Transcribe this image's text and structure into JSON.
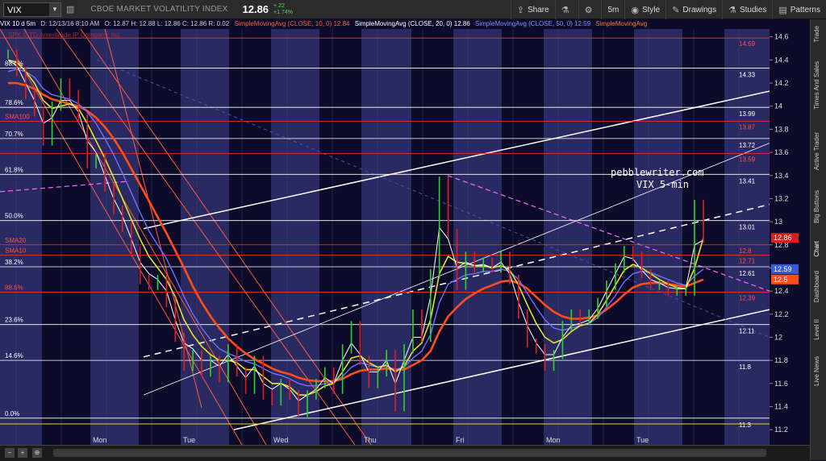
{
  "toolbar": {
    "symbol": "VIX",
    "company": "CBOE MARKET VOLATILITY INDEX",
    "last": "12.86",
    "change": "+.22",
    "change_pct": "+1.74%",
    "buttons": [
      {
        "label": "Share",
        "icon": "share-icon"
      },
      {
        "label": "",
        "icon": "flask-icon"
      },
      {
        "label": "",
        "icon": "gear-icon"
      },
      {
        "label": "5m",
        "icon": ""
      },
      {
        "label": "Style",
        "icon": "eye-icon"
      },
      {
        "label": "Drawings",
        "icon": "pencil-icon"
      },
      {
        "label": "Studies",
        "icon": "flask-icon"
      },
      {
        "label": "Patterns",
        "icon": "patterns-icon"
      }
    ]
  },
  "infobar": {
    "title": "VIX 10 d 5m",
    "date": "D: 12/13/16 8:10 AM",
    "ohlc": "O: 12.87  H: 12.88  L: 12.86  C: 12.86  R: 0.02",
    "sma10": "SimpleMovingAvg (CLOSE, 10, 0)  12.84",
    "sma20": "SimpleMovingAvg (CLOSE, 20, 0)  12.86",
    "sma50": "SimpleMovingAvg (CLOSE, 50, 0)  12.59",
    "sma100": "SimpleMovingAvg",
    "watermark": "SPX © TD Ameritrade IP Company, Inc."
  },
  "sidebar": [
    "Trade",
    "Times And Sales",
    "Active Trader",
    "Big Buttons",
    "Chart",
    "Dashboard",
    "Level II",
    "Live News"
  ],
  "annotation": {
    "line1": "pebblewriter.com",
    "line2": "VIX 5-min"
  },
  "colors": {
    "price": "#d32020",
    "sma10": "#ffffff",
    "sma20": "#e8e030",
    "sma50": "#7070ff",
    "sma100": "#ff4d1a",
    "fib": "#ffffff",
    "channel": "#ff5a3c",
    "pink": "#ff66ff"
  },
  "chart_data": {
    "type": "line",
    "title": "VIX 10 d 5m",
    "y_ticks": [
      11.2,
      11.4,
      11.6,
      11.8,
      12,
      12.2,
      12.4,
      12.6,
      12.8,
      13,
      13.2,
      13.4,
      13.6,
      13.8,
      14,
      14.2,
      14.4,
      14.6
    ],
    "ylim": [
      11.18,
      14.64
    ],
    "x_labels": [
      "Mon",
      "Tue",
      "Wed",
      "Thu",
      "Fri",
      "Mon",
      "Tue"
    ],
    "fib_levels": [
      {
        "pct": "88.6%",
        "value": 14.33
      },
      {
        "pct": "78.6%",
        "value": 13.99
      },
      {
        "pct": "70.7%",
        "value": 13.72
      },
      {
        "pct": "61.8%",
        "value": 13.41
      },
      {
        "pct": "50.0%",
        "value": 13.01
      },
      {
        "pct": "38.2%",
        "value": 12.61
      },
      {
        "pct": "23.6%",
        "value": 12.11
      },
      {
        "pct": "14.6%",
        "value": 11.8
      },
      {
        "pct": "0.0%",
        "value": 11.3
      }
    ],
    "red_levels": [
      {
        "pct": "",
        "value": 14.59
      },
      {
        "pct": "SMA100",
        "value": 13.87
      },
      {
        "pct": "",
        "value": 13.59
      },
      {
        "pct": "SMA20",
        "value": 12.8
      },
      {
        "pct": "SMA10",
        "value": 12.71
      },
      {
        "pct": "88.6%",
        "value": 12.39
      }
    ],
    "right_tags": [
      {
        "value": 12.86,
        "color": "#d32020"
      },
      {
        "value": 12.59,
        "color": "#3a5bd8"
      },
      {
        "value": 12.5,
        "color": "#ff4d1a"
      }
    ],
    "price": [
      14.45,
      14.3,
      14.1,
      13.95,
      13.7,
      14.0,
      14.2,
      14.1,
      13.9,
      13.5,
      13.55,
      13.3,
      13.1,
      12.95,
      12.75,
      12.5,
      12.45,
      12.5,
      12.3,
      12.0,
      11.75,
      11.85,
      11.7,
      11.8,
      11.65,
      11.9,
      11.7,
      11.55,
      11.8,
      11.5,
      11.45,
      11.6,
      11.5,
      11.35,
      11.5,
      11.6,
      11.7,
      11.55,
      11.9,
      12.1,
      11.8,
      11.6,
      11.7,
      11.85,
      11.4,
      11.9,
      12.2,
      12.0,
      12.55,
      13.35,
      12.9,
      12.45,
      12.7,
      12.6,
      12.65,
      12.6,
      12.7,
      12.5,
      12.2,
      11.95,
      11.9,
      11.75,
      11.85,
      12.1,
      12.2,
      12.15,
      12.2,
      12.3,
      12.45,
      12.6,
      12.75,
      12.7,
      12.55,
      12.45,
      12.45,
      12.4,
      12.4,
      12.4,
      13.15,
      12.86
    ],
    "sma10": [
      14.4,
      14.35,
      14.2,
      14.05,
      13.85,
      13.9,
      14.05,
      14.05,
      13.95,
      13.7,
      13.6,
      13.4,
      13.2,
      13.05,
      12.85,
      12.65,
      12.55,
      12.5,
      12.4,
      12.15,
      11.95,
      11.9,
      11.8,
      11.8,
      11.75,
      11.85,
      11.75,
      11.65,
      11.75,
      11.6,
      11.55,
      11.6,
      11.55,
      11.45,
      11.5,
      11.55,
      11.65,
      11.6,
      11.8,
      11.95,
      11.85,
      11.7,
      11.7,
      11.8,
      11.6,
      11.8,
      12.0,
      12.0,
      12.35,
      12.95,
      12.85,
      12.6,
      12.65,
      12.62,
      12.63,
      12.6,
      12.65,
      12.55,
      12.3,
      12.1,
      11.95,
      11.85,
      11.85,
      12.0,
      12.1,
      12.12,
      12.15,
      12.25,
      12.4,
      12.55,
      12.7,
      12.68,
      12.58,
      12.5,
      12.47,
      12.43,
      12.42,
      12.42,
      12.8,
      12.84
    ],
    "sma20": [
      14.4,
      14.38,
      14.3,
      14.2,
      14.05,
      13.98,
      14.0,
      14.02,
      13.98,
      13.85,
      13.7,
      13.55,
      13.38,
      13.2,
      13.02,
      12.85,
      12.7,
      12.6,
      12.5,
      12.35,
      12.15,
      12.02,
      11.92,
      11.85,
      11.8,
      11.8,
      11.78,
      11.72,
      11.72,
      11.66,
      11.6,
      11.6,
      11.57,
      11.5,
      11.5,
      11.53,
      11.58,
      11.6,
      11.7,
      11.82,
      11.84,
      11.78,
      11.74,
      11.76,
      11.7,
      11.75,
      11.88,
      11.95,
      12.15,
      12.55,
      12.7,
      12.65,
      12.64,
      12.62,
      12.62,
      12.6,
      12.62,
      12.58,
      12.45,
      12.28,
      12.12,
      12.0,
      11.95,
      11.98,
      12.05,
      12.1,
      12.12,
      12.2,
      12.32,
      12.45,
      12.58,
      12.63,
      12.6,
      12.55,
      12.5,
      12.46,
      12.43,
      12.42,
      12.6,
      12.86
    ],
    "sma50": [
      14.3,
      14.32,
      14.3,
      14.25,
      14.15,
      14.1,
      14.08,
      14.06,
      14.02,
      13.95,
      13.85,
      13.72,
      13.58,
      13.42,
      13.25,
      13.08,
      12.92,
      12.8,
      12.68,
      12.52,
      12.35,
      12.2,
      12.08,
      11.98,
      11.9,
      11.86,
      11.83,
      11.79,
      11.77,
      11.73,
      11.69,
      11.67,
      11.64,
      11.6,
      11.58,
      11.58,
      11.6,
      11.61,
      11.66,
      11.74,
      11.78,
      11.76,
      11.74,
      11.75,
      11.72,
      11.74,
      11.82,
      11.88,
      12.02,
      12.3,
      12.46,
      12.5,
      12.54,
      12.55,
      12.57,
      12.57,
      12.59,
      12.57,
      12.5,
      12.38,
      12.26,
      12.15,
      12.08,
      12.06,
      12.08,
      12.1,
      12.12,
      12.17,
      12.26,
      12.36,
      12.48,
      12.55,
      12.57,
      12.56,
      12.53,
      12.5,
      12.47,
      12.45,
      12.53,
      12.59
    ],
    "sma100": [
      14.2,
      14.2,
      14.18,
      14.15,
      14.1,
      14.06,
      14.04,
      14.02,
      14.0,
      13.96,
      13.9,
      13.82,
      13.72,
      13.6,
      13.46,
      13.32,
      13.18,
      13.04,
      12.9,
      12.75,
      12.6,
      12.44,
      12.3,
      12.18,
      12.08,
      11.99,
      11.92,
      11.86,
      11.81,
      11.77,
      11.73,
      11.7,
      11.68,
      11.65,
      11.63,
      11.62,
      11.62,
      11.62,
      11.64,
      11.68,
      11.71,
      11.72,
      11.72,
      11.73,
      11.72,
      11.72,
      11.76,
      11.8,
      11.88,
      12.05,
      12.18,
      12.26,
      12.33,
      12.38,
      12.42,
      12.45,
      12.48,
      12.49,
      12.47,
      12.42,
      12.35,
      12.28,
      12.22,
      12.18,
      12.16,
      12.16,
      12.17,
      12.19,
      12.24,
      12.3,
      12.37,
      12.43,
      12.46,
      12.47,
      12.47,
      12.46,
      12.45,
      12.44,
      12.47,
      12.5
    ]
  }
}
